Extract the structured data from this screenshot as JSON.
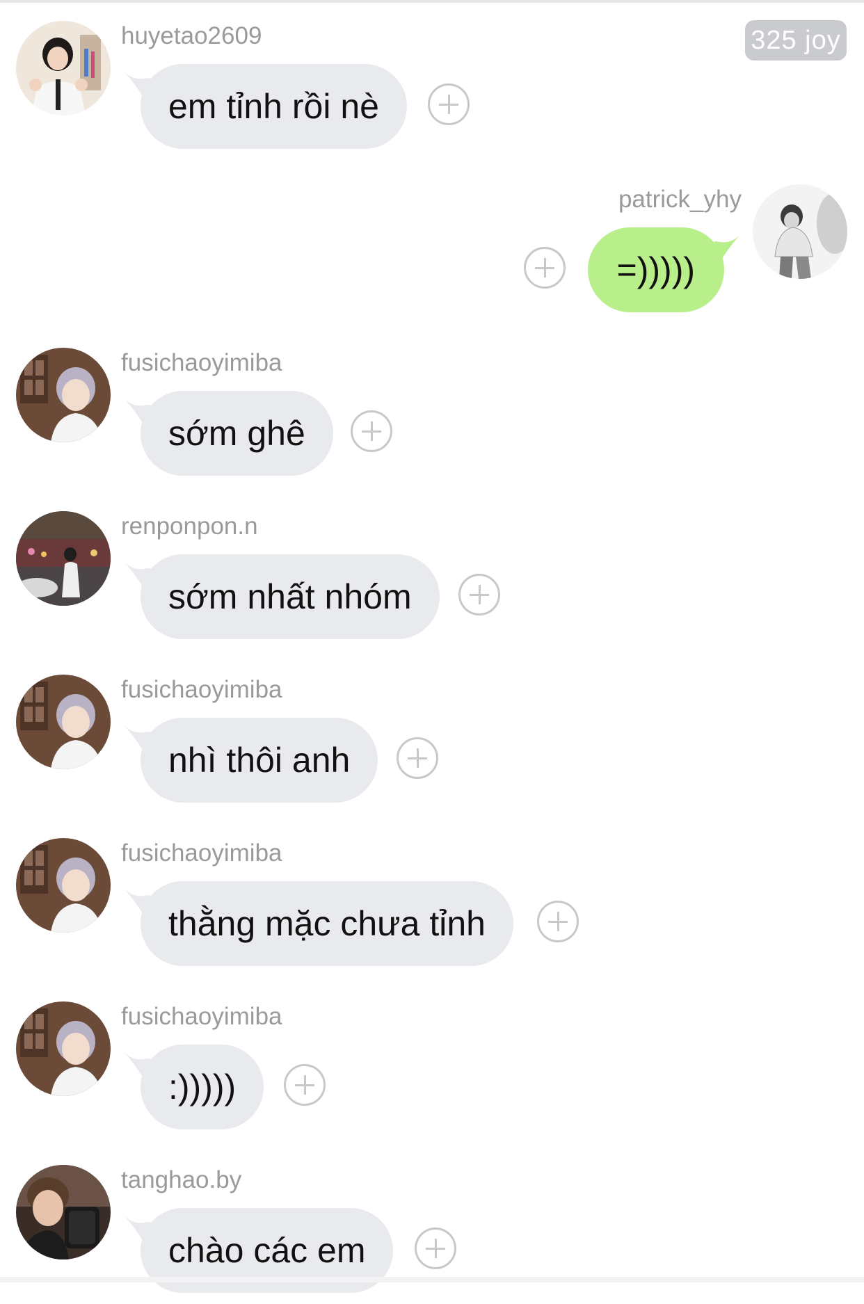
{
  "header": {
    "joy_badge": "325 joy"
  },
  "messages": [
    {
      "username": "huyetao2609",
      "text": "em tỉnh rồi nè",
      "direction": "incoming",
      "avatar": "avatar-photo-huyetao2609"
    },
    {
      "username": "patrick_yhy",
      "text": "=)))))",
      "direction": "outgoing",
      "avatar": "avatar-photo-patrick_yhy"
    },
    {
      "username": "fusichaoyimiba",
      "text": "sớm ghê",
      "direction": "incoming",
      "avatar": "avatar-photo-fusichaoyimiba"
    },
    {
      "username": "renponpon.n",
      "text": "sớm nhất nhóm",
      "direction": "incoming",
      "avatar": "avatar-photo-renponpon"
    },
    {
      "username": "fusichaoyimiba",
      "text": "nhì thôi anh",
      "direction": "incoming",
      "avatar": "avatar-photo-fusichaoyimiba"
    },
    {
      "username": "fusichaoyimiba",
      "text": "thằng mặc chưa tỉnh",
      "direction": "incoming",
      "avatar": "avatar-photo-fusichaoyimiba"
    },
    {
      "username": "fusichaoyimiba",
      "text": ":)))))",
      "direction": "incoming",
      "avatar": "avatar-photo-fusichaoyimiba"
    },
    {
      "username": "tanghao.by",
      "text": "chào các em",
      "direction": "incoming",
      "avatar": "avatar-photo-tanghao"
    }
  ],
  "colors": {
    "incoming_bubble": "#e8eaed",
    "outgoing_bubble": "#b9ef8a",
    "username_text": "#9a9a9a",
    "add_icon": "#c8c8c8",
    "joy_badge_bg": "#c9cbcf"
  },
  "icons": {
    "add_reaction": "plus-circle-icon"
  }
}
